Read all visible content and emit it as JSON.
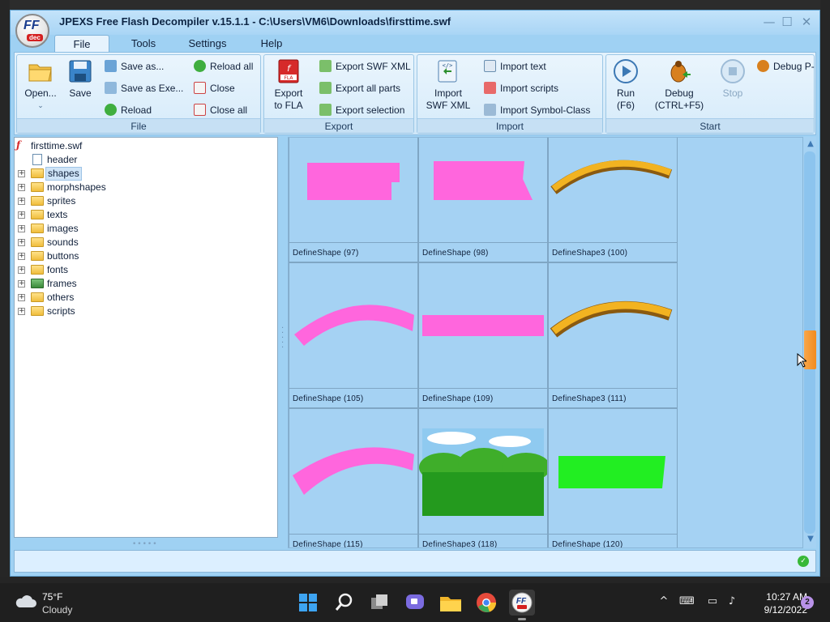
{
  "window": {
    "title": "JPEXS Free Flash Decompiler v.15.1.1 - C:\\Users\\VM6\\Downloads\\firsttime.swf",
    "logo_text": "FF",
    "logo_sub": "dec",
    "controls": {
      "minimize": "—",
      "maximize": "☐",
      "close": "✕"
    }
  },
  "menu": {
    "tabs": [
      {
        "label": "File",
        "active": true
      },
      {
        "label": "Tools",
        "active": false
      },
      {
        "label": "Settings",
        "active": false
      },
      {
        "label": "Help",
        "active": false
      }
    ]
  },
  "ribbon": {
    "file_group": {
      "label": "File",
      "open": "Open...",
      "save": "Save",
      "save_as": "Save as...",
      "save_as_exe": "Save as Exe...",
      "reload": "Reload",
      "reload_all": "Reload all",
      "close": "Close",
      "close_all": "Close all"
    },
    "export_group": {
      "label": "Export",
      "export_to_fla_line1": "Export",
      "export_to_fla_line2": "to FLA",
      "export_swf_xml": "Export SWF XML",
      "export_all_parts": "Export all parts",
      "export_selection": "Export selection"
    },
    "import_group": {
      "label": "Import",
      "import_swf_xml_line1": "Import",
      "import_swf_xml_line2": "SWF XML",
      "import_text": "Import text",
      "import_scripts": "Import scripts",
      "import_symbol_class": "Import Symbol-Class"
    },
    "start_group": {
      "label": "Start",
      "run_line1": "Run",
      "run_line2": "(F6)",
      "debug_line1": "Debug",
      "debug_line2": "(CTRL+F5)",
      "stop": "Stop",
      "debug_p": "Debug P-"
    }
  },
  "tree": {
    "root": "firsttime.swf",
    "items": [
      {
        "label": "header",
        "expandable": false,
        "selected": false
      },
      {
        "label": "shapes",
        "expandable": true,
        "selected": true
      },
      {
        "label": "morphshapes",
        "expandable": true,
        "selected": false
      },
      {
        "label": "sprites",
        "expandable": true,
        "selected": false
      },
      {
        "label": "texts",
        "expandable": true,
        "selected": false
      },
      {
        "label": "images",
        "expandable": true,
        "selected": false
      },
      {
        "label": "sounds",
        "expandable": true,
        "selected": false
      },
      {
        "label": "buttons",
        "expandable": true,
        "selected": false
      },
      {
        "label": "fonts",
        "expandable": true,
        "selected": false
      },
      {
        "label": "frames",
        "expandable": true,
        "selected": false
      },
      {
        "label": "others",
        "expandable": true,
        "selected": false
      },
      {
        "label": "scripts",
        "expandable": true,
        "selected": false
      }
    ]
  },
  "grid": {
    "cells": [
      {
        "caption": "DefineShape (97)",
        "thumb": "magenta-rectangle"
      },
      {
        "caption": "DefineShape (98)",
        "thumb": "magenta-rectangle"
      },
      {
        "caption": "DefineShape3 (100)",
        "thumb": "arched-text-banner"
      },
      {
        "caption": "DefineShape (105)",
        "thumb": "magenta-arc"
      },
      {
        "caption": "DefineShape (109)",
        "thumb": "magenta-bar"
      },
      {
        "caption": "DefineShape3 (111)",
        "thumb": "arched-text-banner"
      },
      {
        "caption": "DefineShape (115)",
        "thumb": "magenta-arc"
      },
      {
        "caption": "DefineShape3 (118)",
        "thumb": "landscape-image"
      },
      {
        "caption": "DefineShape (120)",
        "thumb": "green-rectangle"
      }
    ]
  },
  "colors": {
    "magenta": "#ff66dd",
    "green": "#22ee22",
    "scroll_thumb": "#f18b1f",
    "panel_bg": "#a5d2f3"
  },
  "statusbar": {
    "text": ""
  },
  "taskbar": {
    "weather_temp": "75°F",
    "weather_cond": "Cloudy",
    "time": "10:27 AM",
    "date": "9/12/2022",
    "notifications": "2"
  }
}
